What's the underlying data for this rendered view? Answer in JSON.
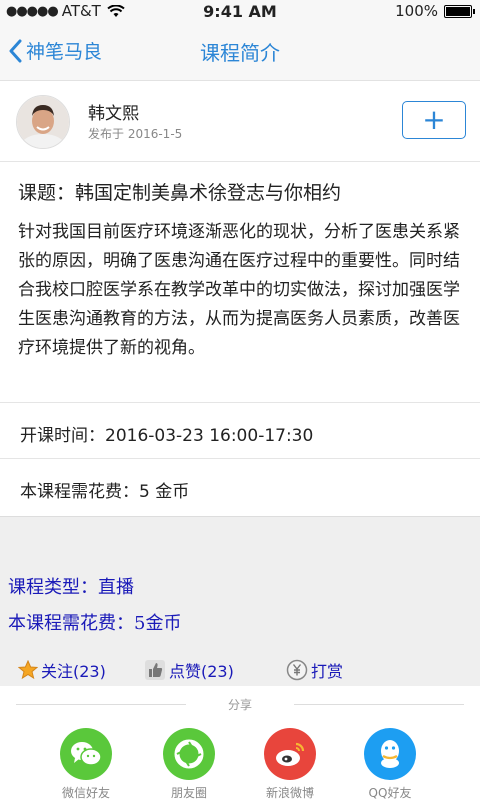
{
  "status": {
    "carrier": "AT&T",
    "time": "9:41 AM",
    "battery": "100%"
  },
  "nav": {
    "back_label": "神笔马良",
    "title": "课程简介"
  },
  "author": {
    "name": "韩文熙",
    "date": "发布于 2016-1-5",
    "follow_symbol": "+"
  },
  "course": {
    "title": "课题：韩国定制美鼻术徐登志与你相约",
    "description": "针对我国目前医疗环境逐渐恶化的现状，分析了医患关系紧张的原因，明确了医患沟通在医疗过程中的重要性。同时结合我校口腔医学系在教学改革中的切实做法，探讨加强医学生医患沟通教育的方法，从而为提高医务人员素质，改善医疗环境提供了新的视角。",
    "time_label": "开课时间：",
    "time_value": "2016-03-23  16:00-17:30",
    "cost": "本课程需花费：5 金币"
  },
  "info": {
    "type_line": "课程类型：直播",
    "cost_line": "本课程需花费：5金币"
  },
  "actions": {
    "follow": "关注(23)",
    "like": "点赞(23)",
    "reward": "打赏"
  },
  "share": {
    "label": "分享",
    "items": [
      {
        "name": "微信好友",
        "color": "#5ac83b",
        "icon": "wechat-icon"
      },
      {
        "name": "朋友圈",
        "color": "#5ac83b",
        "icon": "moments-icon"
      },
      {
        "name": "新浪微博",
        "color": "#e8453c",
        "icon": "weibo-icon"
      },
      {
        "name": "QQ好友",
        "color": "#1d9ef2",
        "icon": "qq-icon"
      }
    ]
  },
  "colors": {
    "accent": "#2c86d6",
    "link_blue": "#1a1ab8"
  }
}
